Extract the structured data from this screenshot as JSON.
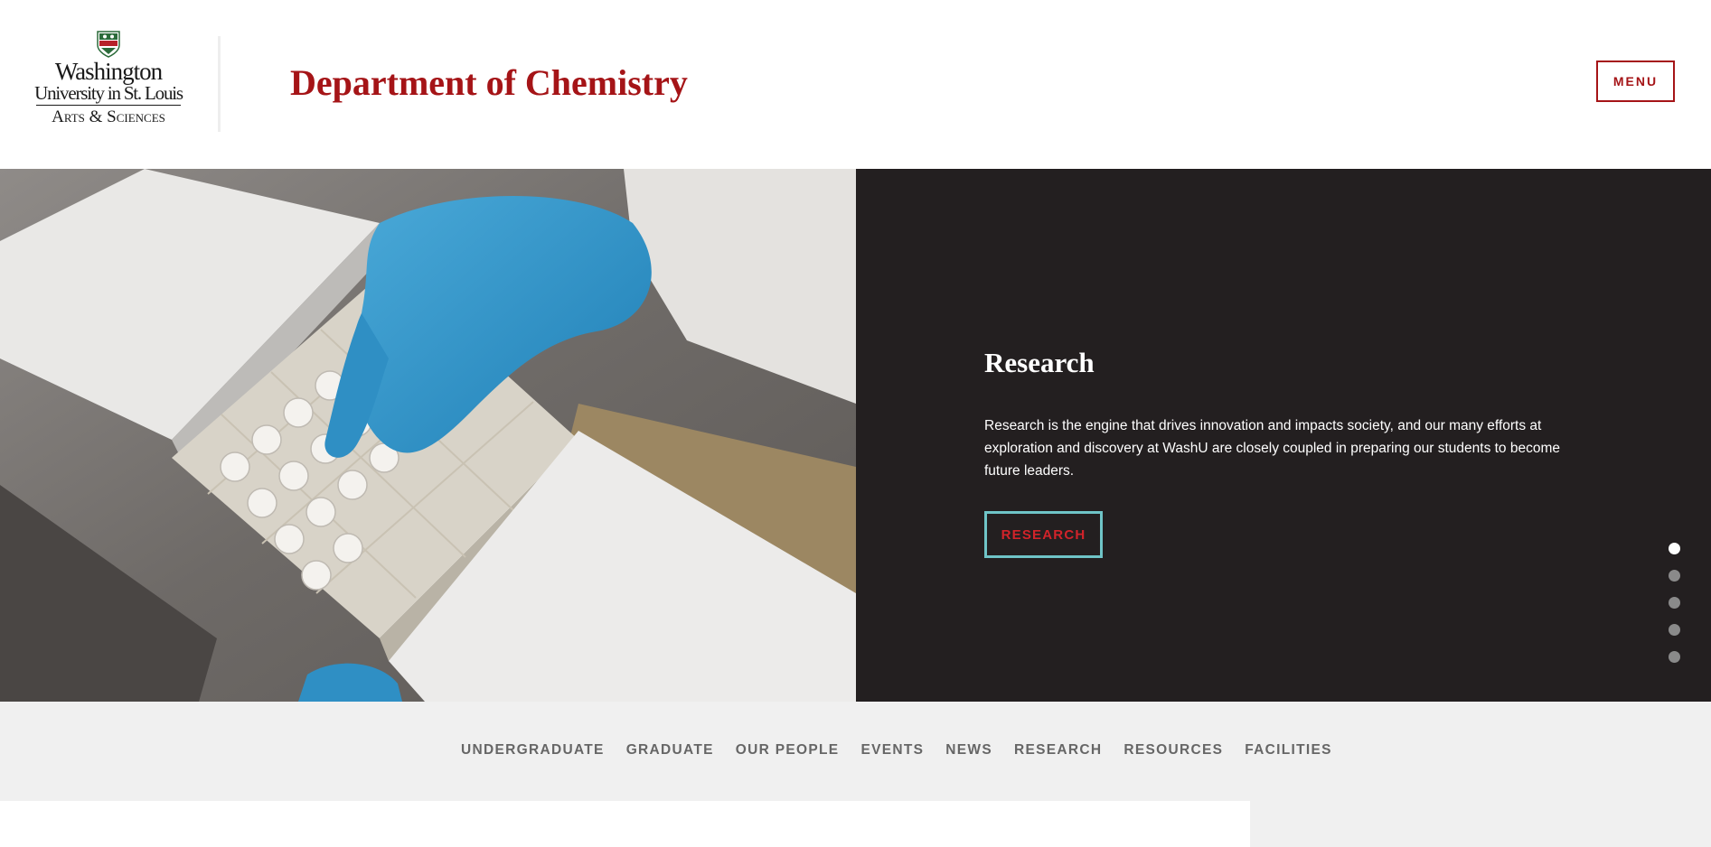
{
  "header": {
    "logo": {
      "line1": "Washington",
      "line2": "University in St. Louis",
      "line3": "Arts & Sciences"
    },
    "title": "Department of Chemistry",
    "menu_label": "MENU"
  },
  "hero": {
    "image_description_icon": "lab-freezer-sample-box-photo",
    "slide": {
      "title": "Research",
      "text": "Research is the engine that drives innovation and impacts society, and our many efforts at exploration and discovery at WashU are closely coupled in preparing our students to become future leaders.",
      "button_label": "RESEARCH"
    },
    "dots": {
      "count": 5,
      "active_index": 0
    }
  },
  "nav": {
    "items": [
      {
        "label": "UNDERGRADUATE"
      },
      {
        "label": "GRADUATE"
      },
      {
        "label": "OUR PEOPLE"
      },
      {
        "label": "EVENTS"
      },
      {
        "label": "NEWS"
      },
      {
        "label": "RESEARCH"
      },
      {
        "label": "RESOURCES"
      },
      {
        "label": "FACILITIES"
      }
    ]
  },
  "colors": {
    "brand_red": "#a51417",
    "panel_dark": "#231f20",
    "accent_teal": "#6fc4c7",
    "nav_bg": "#f0f0f0"
  }
}
